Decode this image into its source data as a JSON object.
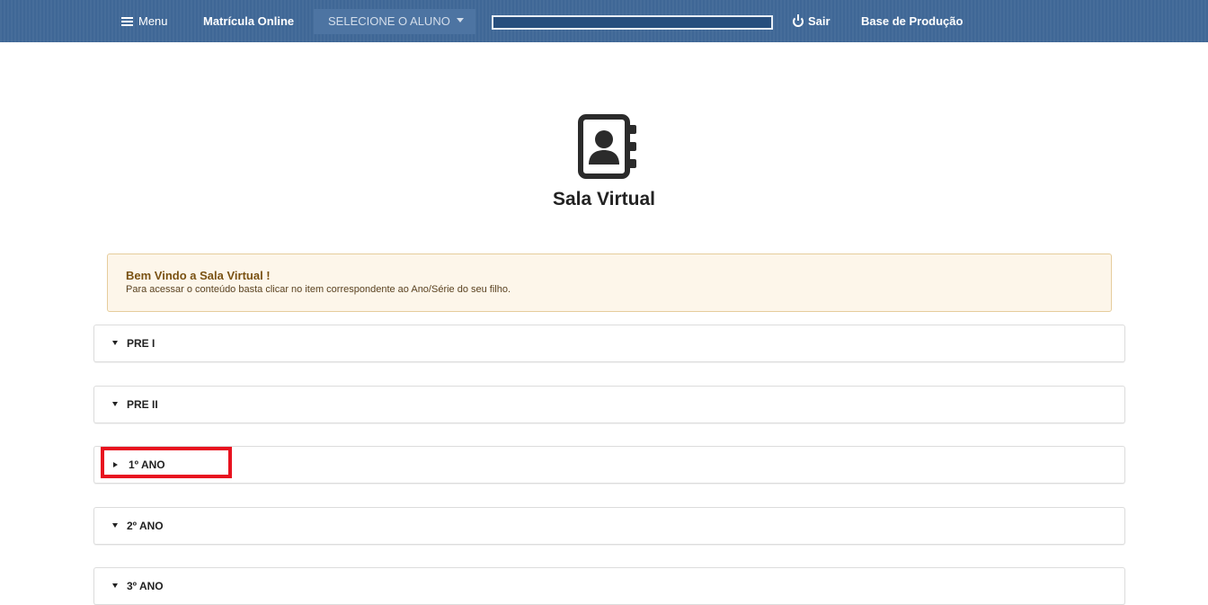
{
  "navbar": {
    "menu_label": "Menu",
    "brand": "Matrícula Online",
    "select_student": "SELECIONE O ALUNO",
    "logout_label": "Sair",
    "environment": "Base de Produção",
    "bg_color": "#3f6796"
  },
  "hero": {
    "icon": "contact-book-icon",
    "title": "Sala Virtual"
  },
  "alert": {
    "title": "Bem Vindo a Sala Virtual !",
    "text": "Para acessar o conteúdo basta clicar no item correspondente ao Ano/Série do seu filho."
  },
  "accordion": [
    {
      "label": "PRE I",
      "state": "expanded"
    },
    {
      "label": "PRE II",
      "state": "expanded"
    },
    {
      "label": "1º ANO",
      "state": "collapsed",
      "highlighted": true
    },
    {
      "label": "2º ANO",
      "state": "expanded"
    },
    {
      "label": "3º ANO",
      "state": "expanded"
    }
  ],
  "highlight_color": "#e8121f"
}
